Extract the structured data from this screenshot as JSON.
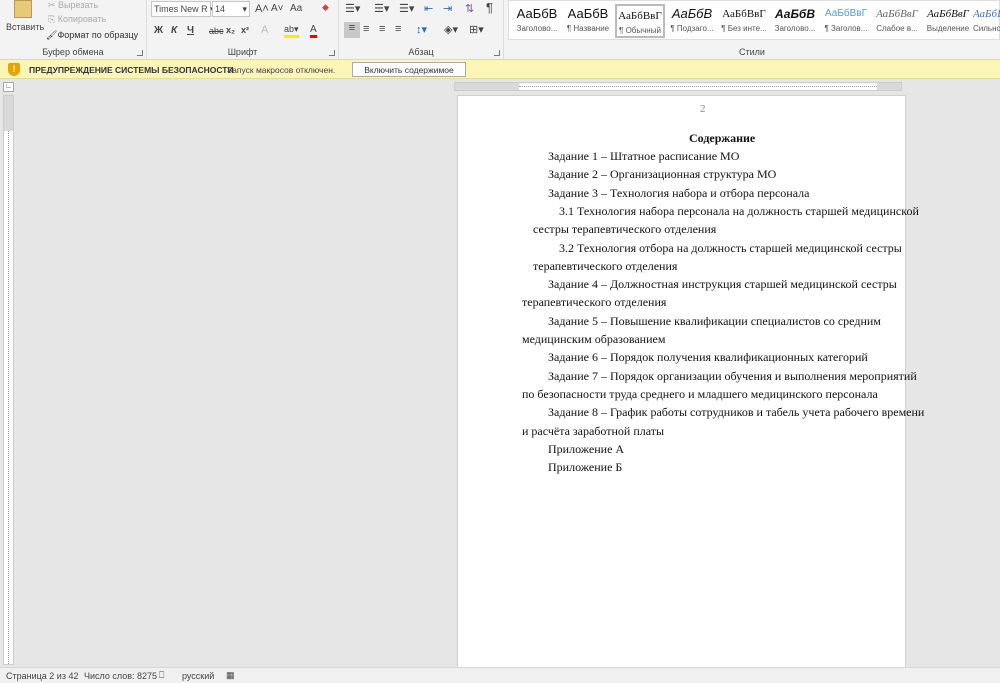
{
  "ribbon": {
    "clipboard": {
      "paste": "Вставить",
      "cut": "Вырезать",
      "copy": "Копировать",
      "format_painter": "Формат по образцу",
      "label": "Буфер обмена"
    },
    "font": {
      "name": "Times New R",
      "size": "14",
      "bold": "Ж",
      "italic": "К",
      "underline": "Ч",
      "strike": "abc",
      "sub": "x₂",
      "sup": "x²",
      "case": "Aa",
      "grow": "A˄",
      "shrink": "A˅",
      "label": "Шрифт"
    },
    "paragraph": {
      "label": "Абзац",
      "pilcrow": "¶"
    },
    "styles": {
      "label": "Стили",
      "items": [
        {
          "preview": "АаБбВ",
          "name": "Заголово..."
        },
        {
          "preview": "АаБбВ",
          "name": "¶ Название"
        },
        {
          "preview": "АаБбВвГ",
          "name": "¶ Обычный",
          "selected": true
        },
        {
          "preview": "АаБбВ",
          "name": "¶ Подзаго..."
        },
        {
          "preview": "АаБбВвГ",
          "name": "¶ Без инте..."
        },
        {
          "preview": "АаБбВ",
          "name": "Заголово..."
        },
        {
          "preview": "АаБбВвГ",
          "name": "¶ Заголов..."
        },
        {
          "preview": "АаБбВвГ",
          "name": "Слабое в..."
        },
        {
          "preview": "АаБбВвГ",
          "name": "Выделение"
        },
        {
          "preview": "АаБбВ",
          "name": "Сильно..."
        }
      ]
    }
  },
  "security": {
    "title": "ПРЕДУПРЕЖДЕНИЕ СИСТЕМЫ БЕЗОПАСНОСТИ",
    "message": "Запуск макросов отключен.",
    "button": "Включить содержимое",
    "color": "#fcf5b8"
  },
  "document": {
    "page_number": "2",
    "heading": "Содержание",
    "entries": [
      {
        "lines": [
          "Задание 1 – Штатное расписание МО"
        ],
        "level": 0
      },
      {
        "lines": [
          "Задание 2 – Организационная структура МО"
        ],
        "level": 0
      },
      {
        "lines": [
          "Задание 3 – Технология набора и отбора персонала"
        ],
        "level": 0
      },
      {
        "lines": [
          "3.1 Технология набора персонала на должность старшей медицинской",
          "сестры терапевтического отделения"
        ],
        "level": 1
      },
      {
        "lines": [
          "3.2 Технология отбора на должность старшей медицинской сестры",
          "терапевтического отделения"
        ],
        "level": 1
      },
      {
        "lines": [
          "Задание 4 – Должностная инструкция старшей медицинской сестры",
          "терапевтического отделения"
        ],
        "level": 0
      },
      {
        "lines": [
          "Задание 5 – Повышение квалификации специалистов со средним",
          "медицинским образованием"
        ],
        "level": 0
      },
      {
        "lines": [
          "Задание 6 – Порядок получения квалификационных категорий"
        ],
        "level": 0
      },
      {
        "lines": [
          "Задание 7 – Порядок организации обучения и выполнения мероприятий",
          "по безопасности труда среднего и младшего медицинского персонала"
        ],
        "level": 0
      },
      {
        "lines": [
          "Задание 8 – График работы сотрудников и табель учета рабочего времени",
          "и расчёта заработной платы"
        ],
        "level": 0
      },
      {
        "lines": [
          "Приложение А"
        ],
        "level": 0
      },
      {
        "lines": [
          "Приложение Б"
        ],
        "level": 0
      }
    ]
  },
  "status": {
    "page": "Страница 2 из 42",
    "words": "Число слов: 8275",
    "language": "русский"
  }
}
